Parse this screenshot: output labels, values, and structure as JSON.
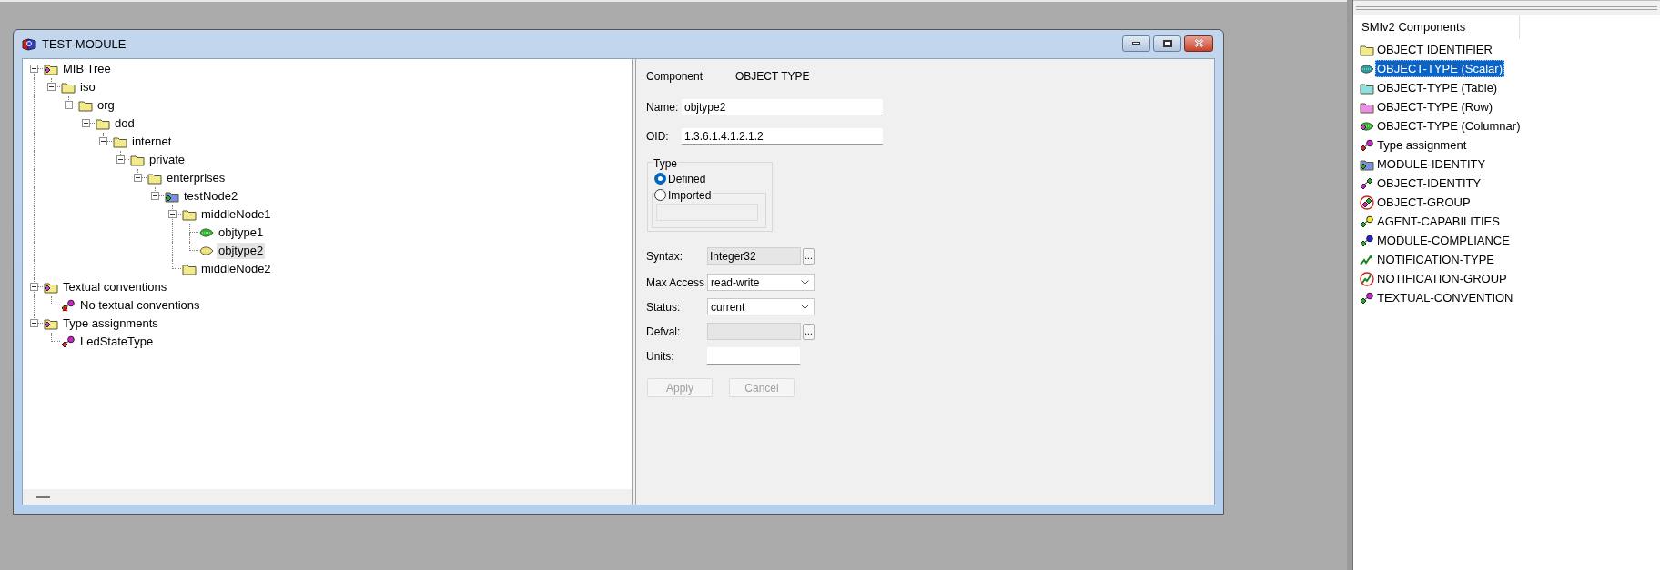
{
  "window": {
    "title": "TEST-MODULE"
  },
  "tree": [
    {
      "label": "MIB Tree",
      "kind": "root",
      "expanded": true,
      "selected": false,
      "children": [
        {
          "label": "iso",
          "kind": "folder",
          "expanded": true,
          "selected": false,
          "children": [
            {
              "label": "org",
              "kind": "folder",
              "expanded": true,
              "selected": false,
              "children": [
                {
                  "label": "dod",
                  "kind": "folder",
                  "expanded": true,
                  "selected": false,
                  "children": [
                    {
                      "label": "internet",
                      "kind": "folder",
                      "expanded": true,
                      "selected": false,
                      "children": [
                        {
                          "label": "private",
                          "kind": "folder",
                          "expanded": true,
                          "selected": false,
                          "children": [
                            {
                              "label": "enterprises",
                              "kind": "folder",
                              "expanded": true,
                              "selected": false,
                              "children": [
                                {
                                  "label": "testNode2",
                                  "kind": "module",
                                  "expanded": true,
                                  "selected": false,
                                  "children": [
                                    {
                                      "label": "middleNode1",
                                      "kind": "folder",
                                      "expanded": true,
                                      "selected": false,
                                      "children": [
                                        {
                                          "label": "objtype1",
                                          "kind": "scalar",
                                          "selected": false
                                        },
                                        {
                                          "label": "objtype2",
                                          "kind": "scalar",
                                          "selected": true
                                        }
                                      ]
                                    },
                                    {
                                      "label": "middleNode2",
                                      "kind": "folder",
                                      "selected": false
                                    }
                                  ]
                                }
                              ]
                            }
                          ]
                        }
                      ]
                    }
                  ]
                }
              ]
            }
          ]
        }
      ]
    },
    {
      "label": "Textual conventions",
      "kind": "root",
      "expanded": true,
      "selected": false,
      "children": [
        {
          "label": "No textual conventions",
          "kind": "none",
          "selected": false
        }
      ]
    },
    {
      "label": "Type assignments",
      "kind": "root",
      "expanded": true,
      "selected": false,
      "children": [
        {
          "label": "LedStateType",
          "kind": "type",
          "selected": false
        }
      ]
    }
  ],
  "form": {
    "component_label": "Component",
    "component_value": "OBJECT TYPE",
    "name": {
      "label": "Name:",
      "value": "objtype2"
    },
    "oid": {
      "label": "OID:",
      "value": "1.3.6.1.4.1.2.1.2"
    },
    "type_group": {
      "label": "Type",
      "options": [
        {
          "label": "Defined",
          "selected": true
        },
        {
          "label": "Imported",
          "selected": false
        }
      ]
    },
    "syntax": {
      "label": "Syntax:",
      "value": "Integer32",
      "button": "..."
    },
    "max_access": {
      "label": "Max Access",
      "value": "read-write"
    },
    "status": {
      "label": "Status:",
      "value": "current"
    },
    "defval": {
      "label": "Defval:",
      "button": "...",
      "disabled": true
    },
    "units": {
      "label": "Units:"
    },
    "buttons": [
      {
        "label": "Apply",
        "disabled": true
      },
      {
        "label": "Cancel",
        "disabled": true
      }
    ]
  },
  "components": {
    "header": "SMIv2 Components",
    "items": [
      {
        "label": "OBJECT IDENTIFIER",
        "kind": "oid",
        "selected": false
      },
      {
        "label": "OBJECT-TYPE (Scalar)",
        "kind": "scalar",
        "selected": true
      },
      {
        "label": "OBJECT-TYPE (Table)",
        "kind": "table",
        "selected": false
      },
      {
        "label": "OBJECT-TYPE (Row)",
        "kind": "row",
        "selected": false
      },
      {
        "label": "OBJECT-TYPE (Columnar)",
        "kind": "columnar",
        "selected": false
      },
      {
        "label": "Type assignment",
        "kind": "type",
        "selected": false
      },
      {
        "label": "MODULE-IDENTITY",
        "kind": "module",
        "selected": false
      },
      {
        "label": "OBJECT-IDENTITY",
        "kind": "identity",
        "selected": false
      },
      {
        "label": "OBJECT-GROUP",
        "kind": "group",
        "selected": false
      },
      {
        "label": "AGENT-CAPABILITIES",
        "kind": "agent",
        "selected": false
      },
      {
        "label": "MODULE-COMPLIANCE",
        "kind": "compliance",
        "selected": false
      },
      {
        "label": "NOTIFICATION-TYPE",
        "kind": "notification",
        "selected": false
      },
      {
        "label": "NOTIFICATION-GROUP",
        "kind": "notification-group",
        "selected": false
      },
      {
        "label": "TEXTUAL-CONVENTION",
        "kind": "tc",
        "selected": false
      }
    ]
  }
}
